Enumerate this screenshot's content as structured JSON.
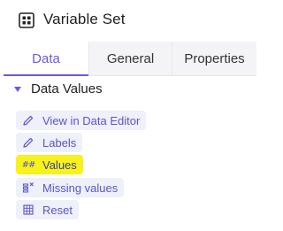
{
  "header": {
    "title": "Variable Set",
    "icon": "grid-icon"
  },
  "tabs": [
    {
      "label": "Data",
      "active": true
    },
    {
      "label": "General",
      "active": false
    },
    {
      "label": "Properties",
      "active": false
    }
  ],
  "section": {
    "label": "Data Values",
    "expanded": true,
    "icon": "triangle-down-icon"
  },
  "items": [
    {
      "label": "View in Data Editor",
      "icon": "pencil-icon"
    },
    {
      "label": "Labels",
      "icon": "pencil-icon"
    },
    {
      "label": "Values",
      "icon": "hash-icon",
      "highlighted": true
    },
    {
      "label": "Missing values",
      "icon": "missing-values-icon"
    },
    {
      "label": "Reset",
      "icon": "table-reset-icon"
    }
  ],
  "colors": {
    "accent": "#6b5bd6",
    "item_bg": "#eef0fa",
    "highlight": "#f7f21a"
  }
}
